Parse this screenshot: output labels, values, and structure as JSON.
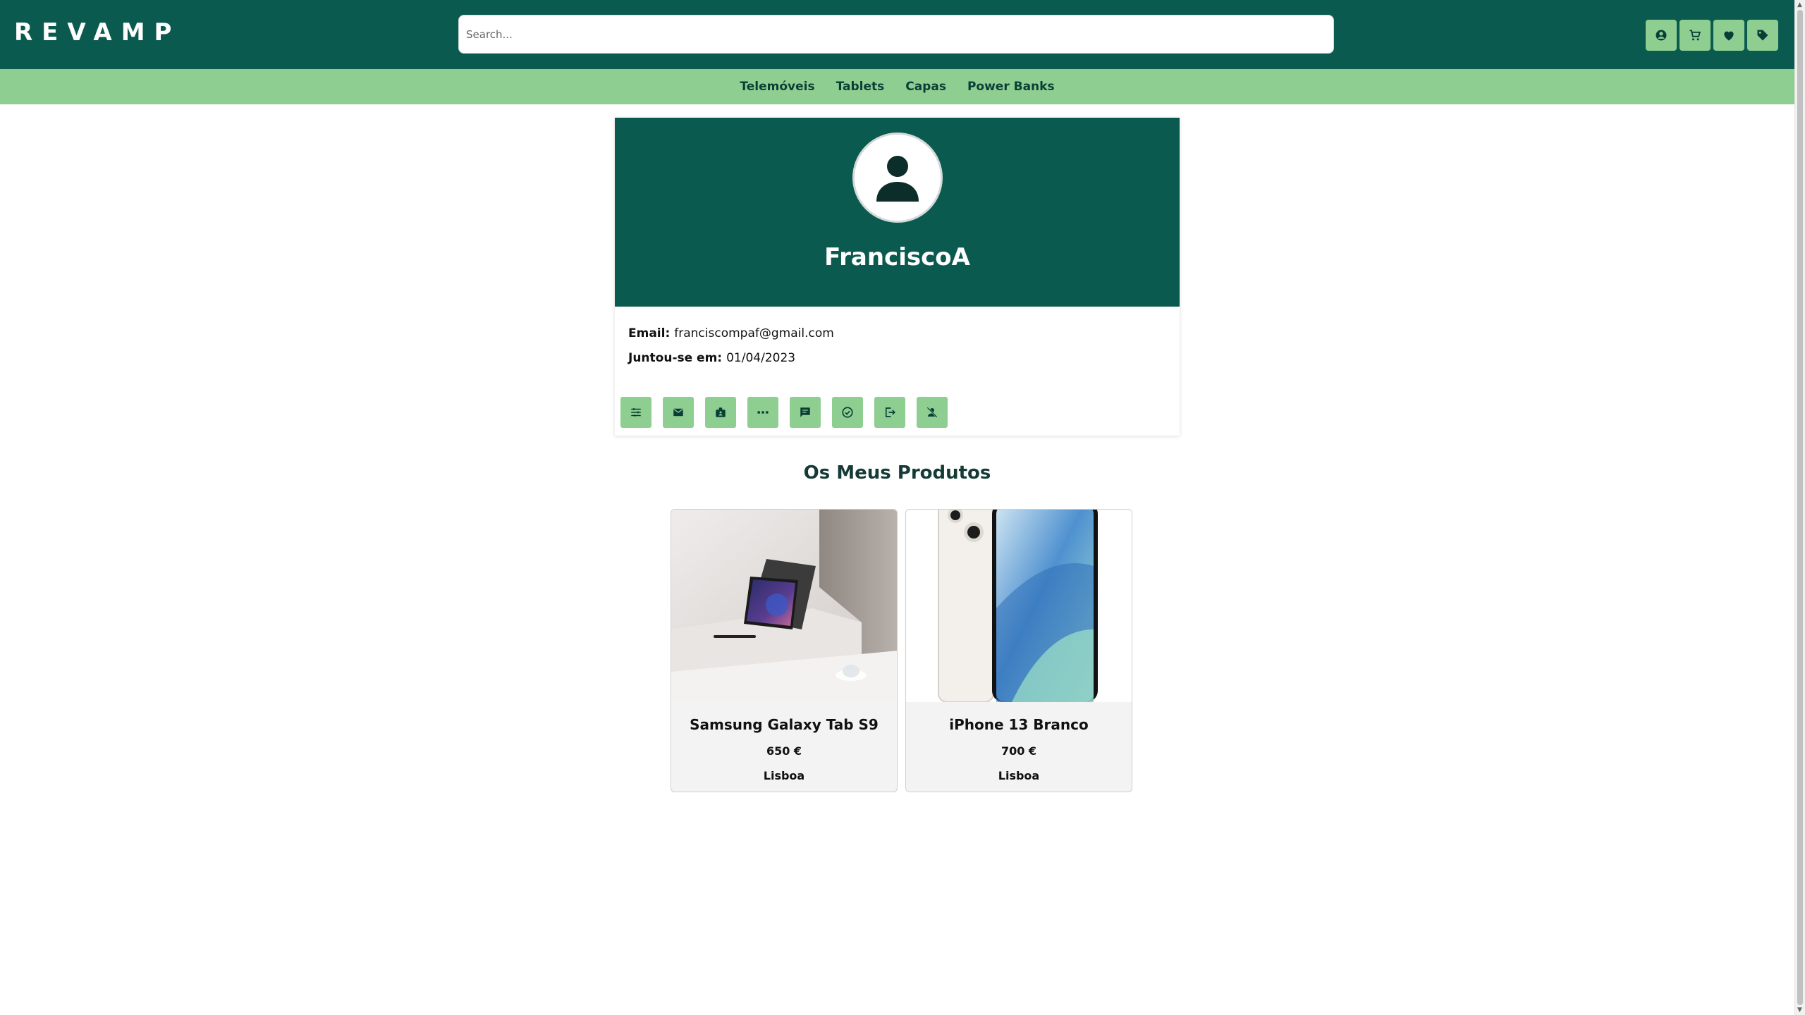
{
  "header": {
    "logo": "REVAMP",
    "search_placeholder": "Search...",
    "icons": [
      "account-icon",
      "cart-icon",
      "heart-icon",
      "tag-icon"
    ]
  },
  "categories": [
    "Telemóveis",
    "Tablets",
    "Capas",
    "Power Banks"
  ],
  "profile": {
    "username": "FranciscoA",
    "email_label": "Email:",
    "email": "franciscompaf@gmail.com",
    "joined_label": "Juntou-se em:",
    "joined": "01/04/2023",
    "actions": [
      "tune-icon",
      "mail-icon",
      "badge-icon",
      "dots-icon",
      "chat-icon",
      "check-circle-icon",
      "logout-icon",
      "delete-user-icon"
    ]
  },
  "products_section": {
    "title": "Os Meus Produtos",
    "items": [
      {
        "name": "Samsung Galaxy Tab S9",
        "price": "650 €",
        "location": "Lisboa"
      },
      {
        "name": "iPhone 13 Branco",
        "price": "700 €",
        "location": "Lisboa"
      }
    ]
  },
  "colors": {
    "primary": "#0b5a50",
    "accent": "#8ecf91"
  }
}
